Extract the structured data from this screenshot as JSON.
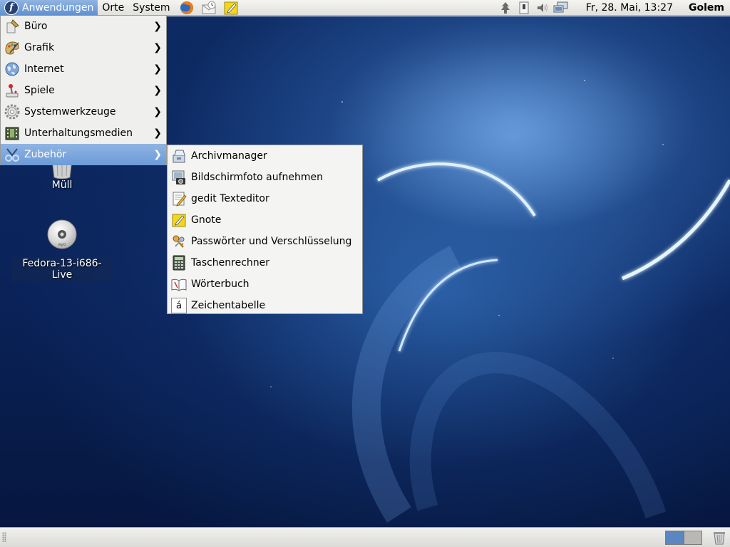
{
  "top_panel": {
    "menus": [
      {
        "label": "Anwendungen",
        "icon": "fedora-logo-icon",
        "active": true
      },
      {
        "label": "Orte"
      },
      {
        "label": "System"
      }
    ],
    "launchers": [
      "firefox-icon",
      "evolution-mail-icon",
      "gnote-notes-icon"
    ],
    "tray_icons": [
      "update-tree-icon",
      "usb-device-icon",
      "volume-icon",
      "network-icon"
    ],
    "clock": "Fr, 28. Mai, 13:27",
    "user": "Golem"
  },
  "applications_menu": {
    "items": [
      {
        "label": "Büro",
        "icon": "office-icon"
      },
      {
        "label": "Grafik",
        "icon": "graphics-icon"
      },
      {
        "label": "Internet",
        "icon": "internet-globe-icon"
      },
      {
        "label": "Spiele",
        "icon": "games-joystick-icon"
      },
      {
        "label": "Systemwerkzeuge",
        "icon": "system-tools-gear-icon"
      },
      {
        "label": "Unterhaltungsmedien",
        "icon": "multimedia-film-icon"
      },
      {
        "label": "Zubehör",
        "icon": "accessories-icon",
        "active": true
      }
    ]
  },
  "accessories_submenu": {
    "items": [
      {
        "label": "Archivmanager",
        "icon": "archive-manager-icon"
      },
      {
        "label": "Bildschirmfoto aufnehmen",
        "icon": "screenshot-camera-icon"
      },
      {
        "label": "gedit Texteditor",
        "icon": "text-editor-icon"
      },
      {
        "label": "Gnote",
        "icon": "gnote-icon"
      },
      {
        "label": "Passwörter und Verschlüsselung",
        "icon": "passwords-keys-icon"
      },
      {
        "label": "Taschenrechner",
        "icon": "calculator-icon"
      },
      {
        "label": "Wörterbuch",
        "icon": "dictionary-icon"
      },
      {
        "label": "Zeichentabelle",
        "icon": "character-map-icon",
        "glyph": "á"
      }
    ]
  },
  "desktop_icons": [
    {
      "label": "Müll",
      "icon": "trash-can-icon"
    },
    {
      "label": "Fedora-13-i686-Live",
      "icon": "cd-disc-icon",
      "disc_label": "ayo"
    }
  ],
  "bottom_panel": {
    "workspaces": [
      {
        "active": true
      },
      {
        "active": false
      }
    ],
    "trash_icon": "trash-applet-icon"
  },
  "colors": {
    "panel": "#e6e5e1",
    "menu_highlight": "#7aa5dc",
    "desktop_deep": "#0a2258",
    "desktop_glow": "#4f86c8",
    "fedora_blue": "#294172"
  }
}
